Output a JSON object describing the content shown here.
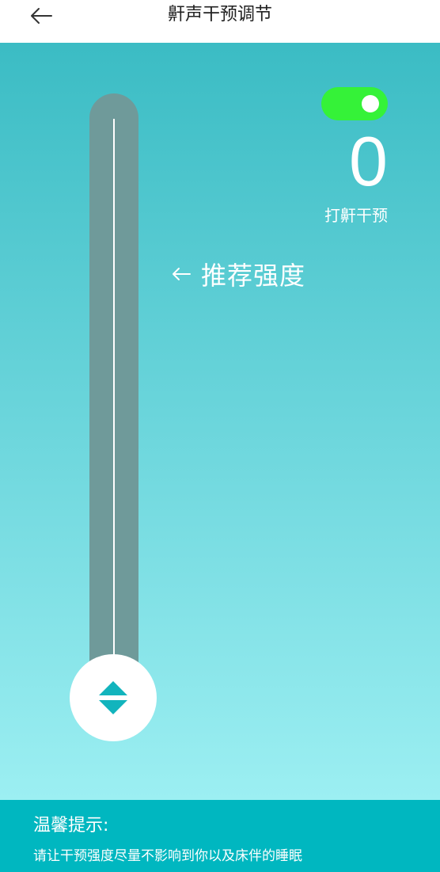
{
  "header": {
    "title": "鼾声干预调节",
    "back_icon": "arrow-left-icon"
  },
  "colors": {
    "gradient_top": "#3bbcc4",
    "gradient_bottom": "#9ceff2",
    "track": "#6f9a9a",
    "toggle_on": "#35f238",
    "tips_background": "#00b7c0",
    "handle_arrows": "#12b4bd"
  },
  "intervention": {
    "enabled": true,
    "level": "0",
    "level_label": "打鼾干预"
  },
  "slider": {
    "recommend_label": "推荐强度",
    "recommend_icon": "arrow-left-icon",
    "handle_icon": "up-down-arrows-icon"
  },
  "tips": {
    "title": "温馨提示:",
    "text": "请让干预强度尽量不影响到你以及床伴的睡眠"
  }
}
